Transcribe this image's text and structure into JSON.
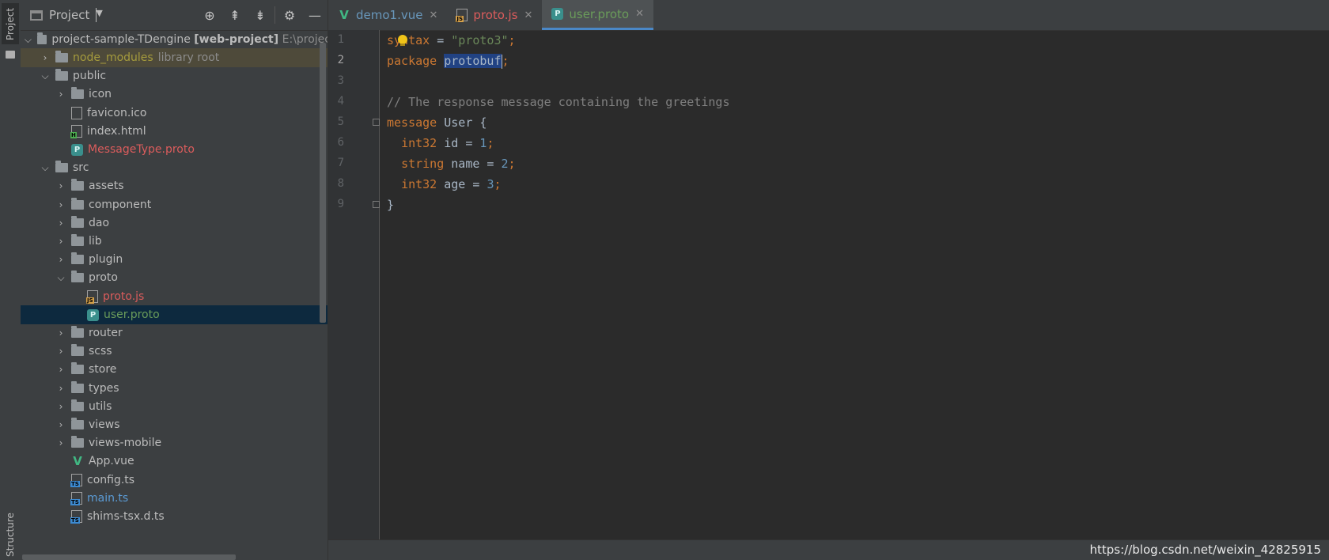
{
  "strip": {
    "project_label": "Project",
    "structure_label": "Structure"
  },
  "panel": {
    "title": "Project",
    "tree": {
      "root_name": "project-sample-TDengine",
      "root_module": "[web-project]",
      "root_path": "E:\\projec",
      "node_modules": "node_modules",
      "node_modules_hint": "library root",
      "public": "public",
      "icon": "icon",
      "favicon": "favicon.ico",
      "index_html": "index.html",
      "messagetype": "MessageType.proto",
      "src": "src",
      "assets": "assets",
      "component": "component",
      "dao": "dao",
      "lib": "lib",
      "plugin": "plugin",
      "proto": "proto",
      "proto_js": "proto.js",
      "user_proto": "user.proto",
      "router": "router",
      "scss": "scss",
      "store": "store",
      "types": "types",
      "utils": "utils",
      "views": "views",
      "views_mobile": "views-mobile",
      "app_vue": "App.vue",
      "config_ts": "config.ts",
      "main_ts": "main.ts",
      "shims_ts": "shims-tsx.d.ts"
    }
  },
  "tabs": [
    {
      "label": "demo1.vue"
    },
    {
      "label": "proto.js"
    },
    {
      "label": "user.proto"
    }
  ],
  "editor": {
    "line_numbers": [
      "1",
      "2",
      "3",
      "4",
      "5",
      "6",
      "7",
      "8",
      "9"
    ],
    "code": {
      "l1_kw": "syntax",
      "l1_eq": " = ",
      "l1_str": "\"proto3\"",
      "l1_semi": ";",
      "l2_kw": "package",
      "l2_sel": "protobuf",
      "l2_semi": ";",
      "l4_comment": "// The response message containing the greetings",
      "l5_kw": "message",
      "l5_rest": " User {",
      "l6_kw": "int32",
      "l6_rest": " id = ",
      "l6_num": "1",
      "l7_kw": "string",
      "l7_rest": " name = ",
      "l7_num": "2",
      "l8_kw": "int32",
      "l8_rest": " age = ",
      "l8_num": "3",
      "l9": "}"
    }
  },
  "watermark": "https://blog.csdn.net/weixin_42825915"
}
